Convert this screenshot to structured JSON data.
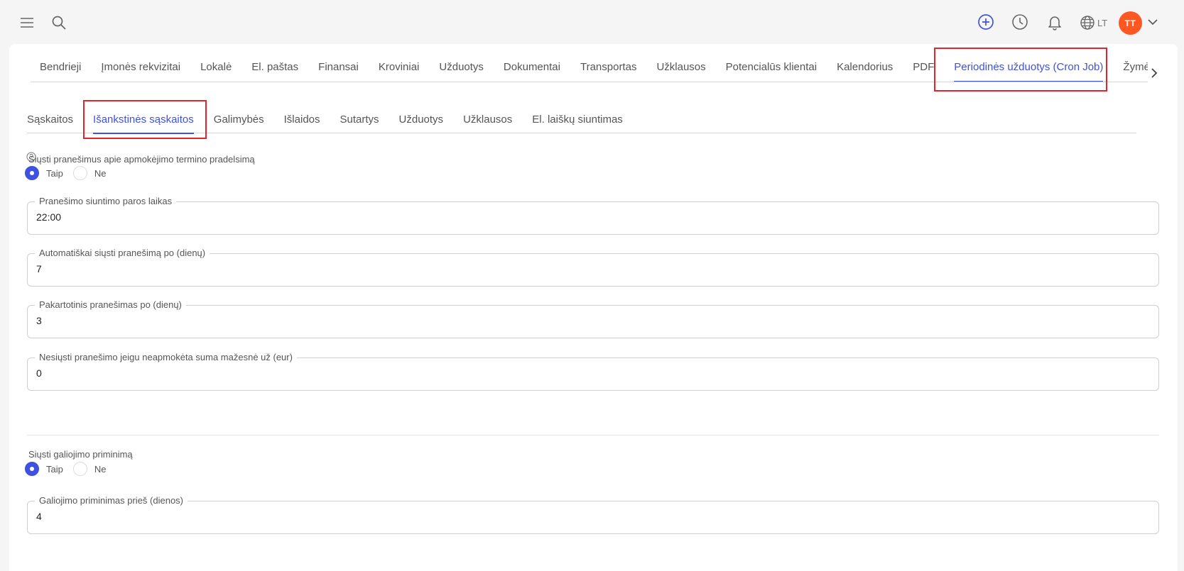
{
  "header": {
    "language": "LT",
    "avatar_initials": "TT"
  },
  "main_tabs": [
    {
      "label": "Bendrieji"
    },
    {
      "label": "Įmonės rekvizitai"
    },
    {
      "label": "Lokalė"
    },
    {
      "label": "El. paštas"
    },
    {
      "label": "Finansai"
    },
    {
      "label": "Kroviniai"
    },
    {
      "label": "Užduotys"
    },
    {
      "label": "Dokumentai"
    },
    {
      "label": "Transportas"
    },
    {
      "label": "Užklausos"
    },
    {
      "label": "Potencialūs klientai"
    },
    {
      "label": "Kalendorius"
    },
    {
      "label": "PDF"
    },
    {
      "label": "Periodinės užduotys (Cron Job)",
      "active": true
    },
    {
      "label": "Žymė"
    }
  ],
  "sub_tabs": [
    {
      "label": "Sąskaitos"
    },
    {
      "label": "Išankstinės sąskaitos",
      "active": true
    },
    {
      "label": "Galimybės"
    },
    {
      "label": "Išlaidos"
    },
    {
      "label": "Sutartys"
    },
    {
      "label": "Užduotys"
    },
    {
      "label": "Užklausos"
    },
    {
      "label": "El. laiškų siuntimas"
    }
  ],
  "form": {
    "overdue_notice": {
      "label": "Siųsti pranešimus apie apmokėjimo termino pradelsimą",
      "options": [
        "Taip",
        "Ne"
      ],
      "selected": "Taip"
    },
    "send_time": {
      "label": "Pranešimo siuntimo paros laikas",
      "value": "22:00"
    },
    "auto_send_after": {
      "label": "Automatiškai siųsti pranešimą po (dienų)",
      "value": "7"
    },
    "repeat_after": {
      "label": "Pakartotinis pranešimas po (dienų)",
      "value": "3"
    },
    "min_amount": {
      "label": "Nesiųsti pranešimo jeigu neapmokėta suma mažesnė už (eur)",
      "value": "0"
    },
    "expiry_reminder": {
      "label": "Siųsti galiojimo priminimą",
      "options": [
        "Taip",
        "Ne"
      ],
      "selected": "Taip"
    },
    "expiry_before": {
      "label": "Galiojimo priminimas prieš (dienos)",
      "value": "4"
    }
  },
  "colors": {
    "accent": "#3f51e0",
    "avatar": "#ff5722",
    "highlight": "#e0262c"
  }
}
